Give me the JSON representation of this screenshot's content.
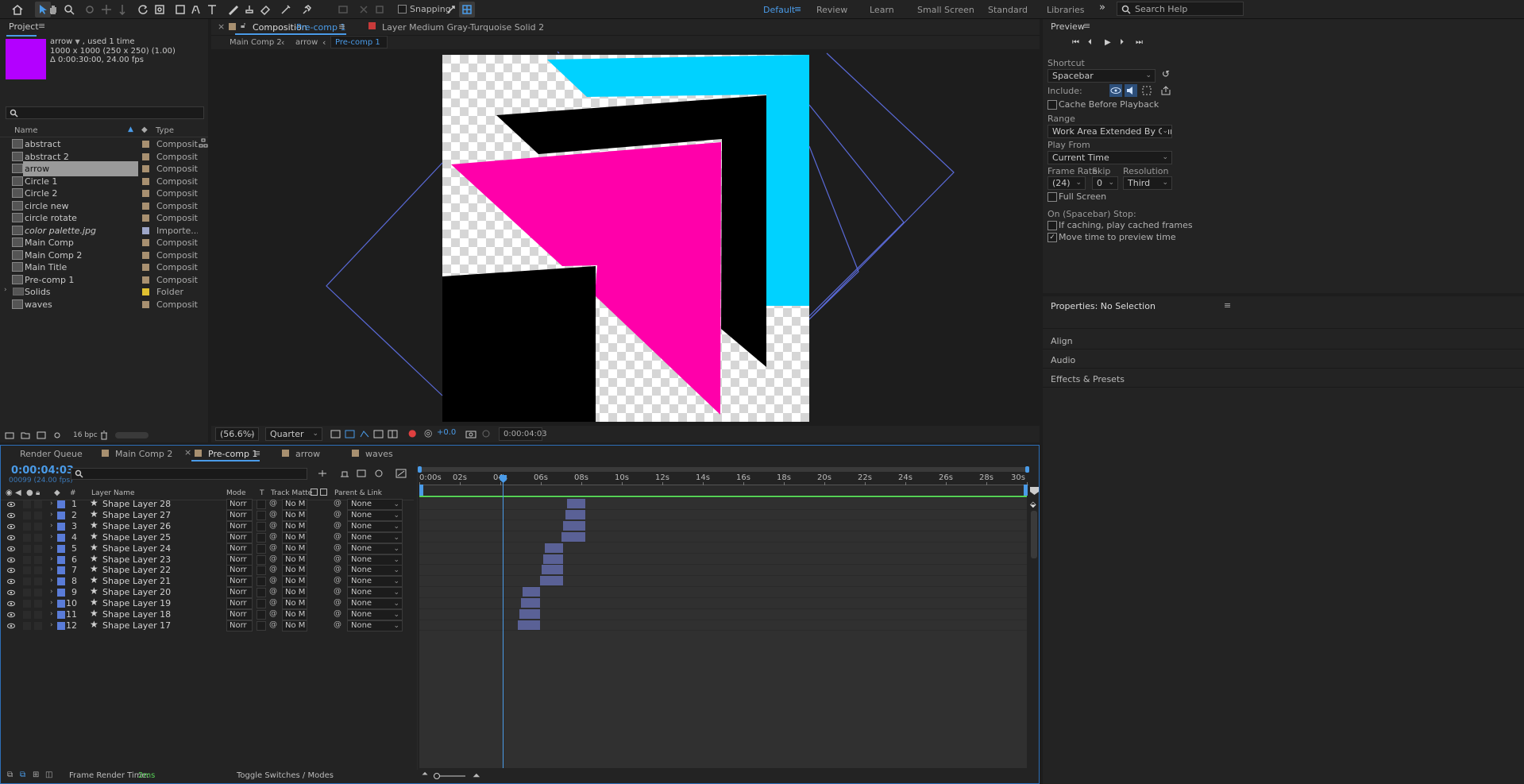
{
  "toolbar": {
    "snapping_label": "Snapping",
    "workspaces": [
      "Default",
      "Review",
      "Learn",
      "Small Screen",
      "Standard",
      "Libraries"
    ],
    "active_workspace": "Default",
    "search_placeholder": "Search Help"
  },
  "project": {
    "title": "Project",
    "selected_name": "arrow",
    "selected_used": ", used 1 time",
    "selected_dims": "1000 x 1000  (250 x 250) (1.00)",
    "selected_duration": "Δ 0:00:30:00, 24.00 fps",
    "thumb_color": "#b300ff",
    "col_name": "Name",
    "col_type": "Type",
    "items": [
      {
        "name": "abstract",
        "type": "Composition",
        "label_color": "#a89070"
      },
      {
        "name": "abstract 2",
        "type": "Composition",
        "label_color": "#a89070"
      },
      {
        "name": "arrow",
        "type": "Composition",
        "label_color": "#a89070"
      },
      {
        "name": "Circle 1",
        "type": "Composition",
        "label_color": "#a89070"
      },
      {
        "name": "Circle 2",
        "type": "Composition",
        "label_color": "#a89070"
      },
      {
        "name": "circle new",
        "type": "Composition",
        "label_color": "#a89070"
      },
      {
        "name": "circle rotate",
        "type": "Composition",
        "label_color": "#a89070"
      },
      {
        "name": "color palette.jpg",
        "type": "Importe...G",
        "label_color": "#9ea6c8"
      },
      {
        "name": "Main Comp",
        "type": "Composition",
        "label_color": "#a89070"
      },
      {
        "name": "Main Comp 2",
        "type": "Composition",
        "label_color": "#a89070"
      },
      {
        "name": "Main Title",
        "type": "Composition",
        "label_color": "#a89070"
      },
      {
        "name": "Pre-comp 1",
        "type": "Composition",
        "label_color": "#a89070"
      },
      {
        "name": "Solids",
        "type": "Folder",
        "label_color": "#e0c030"
      },
      {
        "name": "waves",
        "type": "Composition",
        "label_color": "#a89070"
      }
    ],
    "bpc": "16 bpc"
  },
  "viewer": {
    "comp_tab_prefix": "Composition",
    "comp_tab_name": "Pre-comp 1",
    "layer_tab": "Layer  Medium Gray-Turquoise Solid 2",
    "breadcrumbs": [
      "Main Comp 2",
      "arrow",
      "Pre-comp 1"
    ],
    "zoom": "(56.6%)",
    "resolution": "Quarter",
    "exposure": "+0.0",
    "timecode": "0:00:04:03"
  },
  "preview": {
    "title": "Preview",
    "shortcut_label": "Shortcut",
    "shortcut_value": "Spacebar",
    "include_label": "Include:",
    "cache_before": "Cache Before Playback",
    "range_label": "Range",
    "range_value": "Work Area Extended By Current...",
    "play_from_label": "Play From",
    "play_from_value": "Current Time",
    "frame_rate_label": "Frame Rate",
    "skip_label": "Skip",
    "resolution_label": "Resolution",
    "frame_rate_value": "(24)",
    "skip_value": "0",
    "resolution_value": "Third",
    "full_screen": "Full Screen",
    "stop_label": "On (Spacebar) Stop:",
    "if_caching": "If caching, play cached frames",
    "move_time": "Move time to preview time"
  },
  "properties": {
    "title": "Properties: No Selection",
    "sections": [
      "Align",
      "Audio",
      "Effects & Presets"
    ]
  },
  "timeline": {
    "tabs": [
      "Render Queue",
      "Main Comp 2",
      "Pre-comp 1",
      "arrow",
      "waves"
    ],
    "active_tab": "Pre-comp 1",
    "timecode": "0:00:04:03",
    "frame_info": "00099 (24.00 fps)",
    "col_layer_name": "Layer Name",
    "col_mode": "Mode",
    "col_t": "T",
    "col_track_matte": "Track Matte",
    "col_parent": "Parent & Link",
    "ruler": [
      "0:00s",
      "02s",
      "04s",
      "06s",
      "08s",
      "10s",
      "12s",
      "14s",
      "16s",
      "18s",
      "20s",
      "22s",
      "24s",
      "26s",
      "28s",
      "30s"
    ],
    "layers": [
      {
        "num": "1",
        "name": "Shape Layer 28",
        "mode": "Norr",
        "matte": "No M",
        "parent": "None",
        "bar_start": 7.3,
        "bar_end": 8.2
      },
      {
        "num": "2",
        "name": "Shape Layer 27",
        "mode": "Norr",
        "matte": "No M",
        "parent": "None",
        "bar_start": 7.2,
        "bar_end": 8.2
      },
      {
        "num": "3",
        "name": "Shape Layer 26",
        "mode": "Norr",
        "matte": "No M",
        "parent": "None",
        "bar_start": 7.1,
        "bar_end": 8.2
      },
      {
        "num": "4",
        "name": "Shape Layer 25",
        "mode": "Norr",
        "matte": "No M",
        "parent": "None",
        "bar_start": 7.0,
        "bar_end": 8.2
      },
      {
        "num": "5",
        "name": "Shape Layer 24",
        "mode": "Norr",
        "matte": "No M",
        "parent": "None",
        "bar_start": 6.2,
        "bar_end": 7.1
      },
      {
        "num": "6",
        "name": "Shape Layer 23",
        "mode": "Norr",
        "matte": "No M",
        "parent": "None",
        "bar_start": 6.1,
        "bar_end": 7.1
      },
      {
        "num": "7",
        "name": "Shape Layer 22",
        "mode": "Norr",
        "matte": "No M",
        "parent": "None",
        "bar_start": 6.05,
        "bar_end": 7.1
      },
      {
        "num": "8",
        "name": "Shape Layer 21",
        "mode": "Norr",
        "matte": "No M",
        "parent": "None",
        "bar_start": 5.95,
        "bar_end": 7.1
      },
      {
        "num": "9",
        "name": "Shape Layer 20",
        "mode": "Norr",
        "matte": "No M",
        "parent": "None",
        "bar_start": 5.1,
        "bar_end": 5.95
      },
      {
        "num": "10",
        "name": "Shape Layer 19",
        "mode": "Norr",
        "matte": "No M",
        "parent": "None",
        "bar_start": 5.0,
        "bar_end": 5.95
      },
      {
        "num": "11",
        "name": "Shape Layer 18",
        "mode": "Norr",
        "matte": "No M",
        "parent": "None",
        "bar_start": 4.95,
        "bar_end": 5.95
      },
      {
        "num": "12",
        "name": "Shape Layer 17",
        "mode": "Norr",
        "matte": "No M",
        "parent": "None",
        "bar_start": 4.85,
        "bar_end": 5.95
      }
    ],
    "playhead_seconds": 4.125,
    "frame_render_label": "Frame Render Time:",
    "frame_render_value": "2ms",
    "toggle_label": "Toggle Switches / Modes"
  }
}
